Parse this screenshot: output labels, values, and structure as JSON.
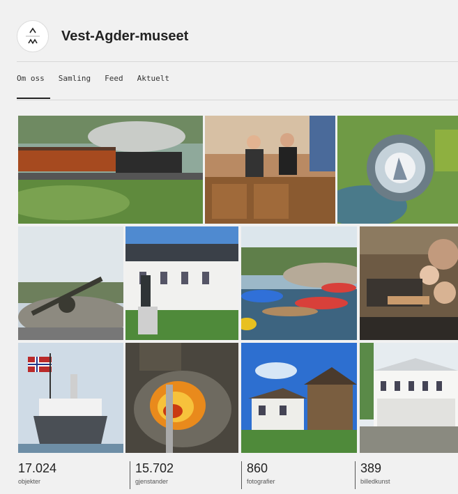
{
  "header": {
    "title": "Vest-Agder-museet",
    "logo_icon": "vest-agder-museet-logo-icon"
  },
  "tabs": [
    {
      "label": "Om oss",
      "active": true
    },
    {
      "label": "Samling",
      "active": false
    },
    {
      "label": "Feed",
      "active": false
    },
    {
      "label": "Aktuelt",
      "active": false
    }
  ],
  "gallery": {
    "photos": [
      {
        "name": "steam-train-photo"
      },
      {
        "name": "museum-shop-photo"
      },
      {
        "name": "aerial-fort-photo"
      },
      {
        "name": "cannon-photo"
      },
      {
        "name": "manor-house-statue-photo"
      },
      {
        "name": "kayaks-photo"
      },
      {
        "name": "craft-workshop-photo"
      },
      {
        "name": "ship-with-flag-photo"
      },
      {
        "name": "glowing-forge-photo"
      },
      {
        "name": "old-farm-buildings-photo"
      },
      {
        "name": "white-house-photo"
      }
    ]
  },
  "stats": [
    {
      "value": "17.024",
      "label": "objekter"
    },
    {
      "value": "15.702",
      "label": "gjenstander"
    },
    {
      "value": "860",
      "label": "fotografier"
    },
    {
      "value": "389",
      "label": "billedkunst"
    }
  ],
  "colors": {
    "background": "#f1f1f1",
    "text": "#222222",
    "rule": "#d7d7d7"
  }
}
